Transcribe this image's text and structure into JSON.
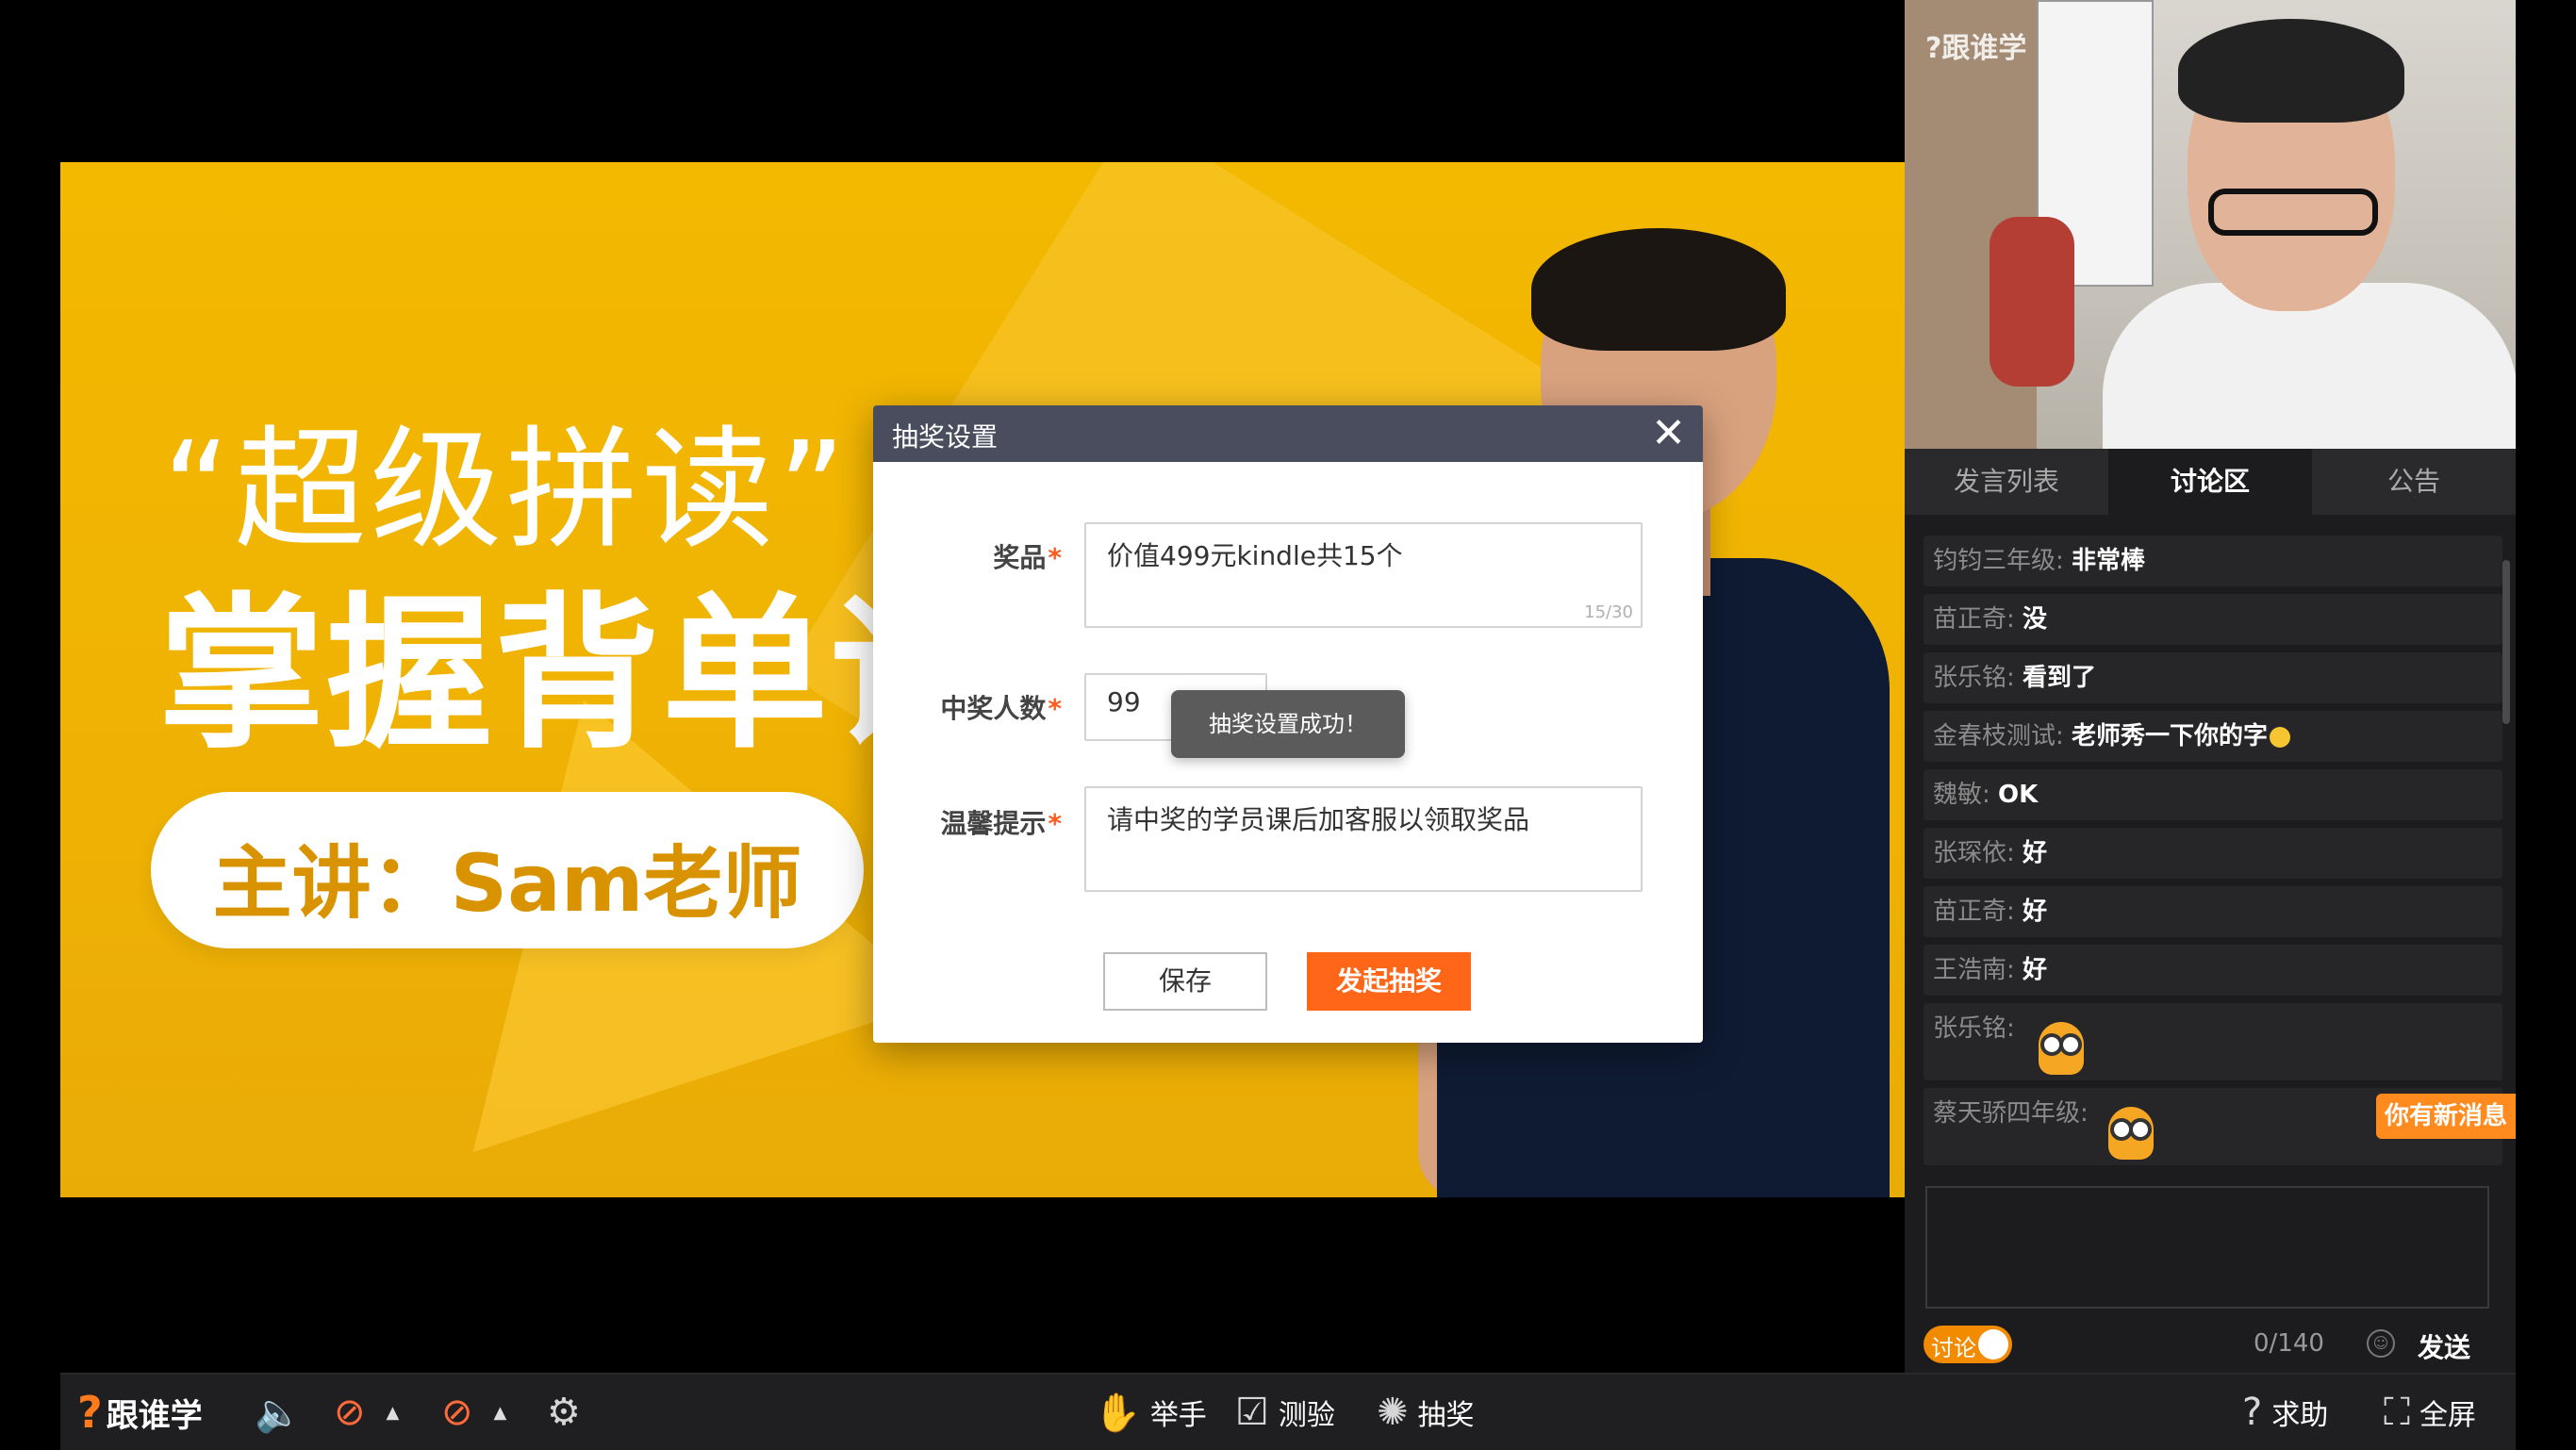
{
  "slide": {
    "line1": "“超级拼读”",
    "line2": "掌握背单词",
    "presenter": "主讲：Sam老师"
  },
  "webcam": {
    "logo": "?跟谁学"
  },
  "panel": {
    "tabs": [
      "发言列表",
      "讨论区",
      "公告"
    ],
    "messages": [
      {
        "name": "钧钧三年级:",
        "text": "非常棒"
      },
      {
        "name": "苗正奇:",
        "text": "没"
      },
      {
        "name": "张乐铭:",
        "text": "看到了"
      },
      {
        "name": "金春枝测试:",
        "text": "老师秀一下你的字"
      },
      {
        "name": "魏敏:",
        "text": "OK"
      },
      {
        "name": "张琛依:",
        "text": "好"
      },
      {
        "name": "苗正奇:",
        "text": "好"
      },
      {
        "name": "王浩南:",
        "text": "好"
      },
      {
        "name": "张乐铭:",
        "text": ""
      },
      {
        "name": "蔡天骄四年级:",
        "text": ""
      }
    ],
    "new_message_badge": "你有新消息",
    "toggle_label": "讨论",
    "char_count": "0/140",
    "send_label": "发送"
  },
  "toolbar": {
    "brand": "跟谁学",
    "raise_hand": "举手",
    "quiz": "测验",
    "lottery": "抽奖",
    "help": "求助",
    "fullscreen": "全屏"
  },
  "modal": {
    "title": "抽奖设置",
    "prize_label": "奖品",
    "prize_value": "价值499元kindle共15个",
    "prize_count": "15/30",
    "winners_label": "中奖人数",
    "winners_value": "99",
    "tip_label": "温馨提示",
    "tip_value": "请中奖的学员课后加客服以领取奖品",
    "toast": "抽奖设置成功！",
    "save_label": "保存",
    "start_label": "发起抽奖"
  },
  "colors": {
    "accent": "#ff6618",
    "slide_bg": "#f3b800",
    "modal_header": "#4a4d5e",
    "panel_bg": "#1c1c1e"
  }
}
